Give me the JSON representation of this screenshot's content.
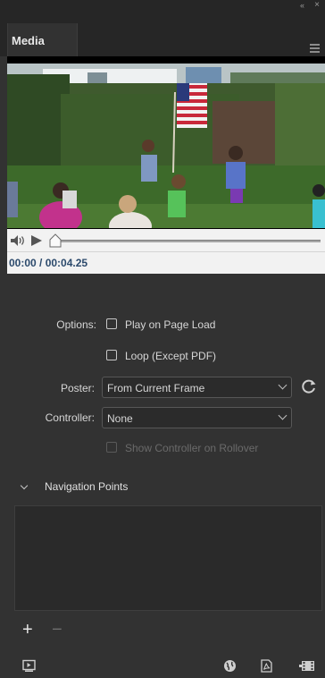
{
  "window": {
    "collapse_glyph": "‹‹",
    "close_glyph": "×"
  },
  "tab": {
    "label": "Media"
  },
  "player": {
    "time_display": "00:00 / 00:04.25"
  },
  "options": {
    "options_label": "Options:",
    "play_on_load_label": "Play on Page Load",
    "loop_label": "Loop (Except PDF)",
    "poster_label": "Poster:",
    "poster_value": "From Current Frame",
    "controller_label": "Controller:",
    "controller_value": "None",
    "show_controller_label": "Show Controller on Rollover"
  },
  "navigation": {
    "header": "Navigation Points",
    "add_glyph": "+",
    "remove_glyph": "−"
  },
  "icons": {
    "menu": "panel-menu-icon",
    "volume": "speaker-icon",
    "play": "play-icon",
    "scrub": "scrubber-thumb-icon",
    "refresh": "refresh-icon",
    "preview": "preview-icon",
    "web": "globe-icon",
    "pdf": "pdf-icon",
    "film": "film-icon"
  },
  "colors": {
    "panel_bg": "#323232",
    "header_bg": "#262626",
    "time_text": "#2c4a6c"
  }
}
